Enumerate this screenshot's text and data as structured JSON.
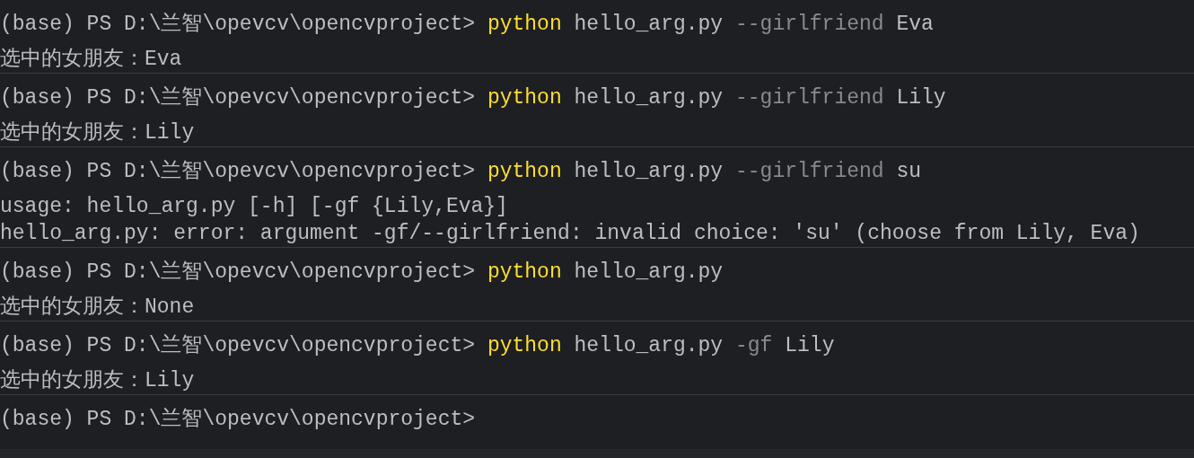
{
  "blocks": [
    {
      "prompt": "(base) PS D:\\兰智\\opevcv\\opencvproject>",
      "command": [
        {
          "text": "python",
          "kind": "program"
        },
        {
          "text": "hello_arg.py",
          "kind": "argument"
        },
        {
          "text": "--girlfriend",
          "kind": "flag"
        },
        {
          "text": "Eva",
          "kind": "argument"
        }
      ],
      "output": [
        "选中的女朋友：Eva"
      ]
    },
    {
      "prompt": "(base) PS D:\\兰智\\opevcv\\opencvproject>",
      "command": [
        {
          "text": "python",
          "kind": "program"
        },
        {
          "text": "hello_arg.py",
          "kind": "argument"
        },
        {
          "text": "--girlfriend",
          "kind": "flag"
        },
        {
          "text": "Lily",
          "kind": "argument"
        }
      ],
      "output": [
        "选中的女朋友：Lily"
      ]
    },
    {
      "prompt": "(base) PS D:\\兰智\\opevcv\\opencvproject>",
      "command": [
        {
          "text": "python",
          "kind": "program"
        },
        {
          "text": "hello_arg.py",
          "kind": "argument"
        },
        {
          "text": "--girlfriend",
          "kind": "flag"
        },
        {
          "text": "su",
          "kind": "argument"
        }
      ],
      "output": [
        "usage: hello_arg.py [-h] [-gf {Lily,Eva}]",
        "hello_arg.py: error: argument -gf/--girlfriend: invalid choice: 'su' (choose from Lily, Eva)"
      ]
    },
    {
      "prompt": "(base) PS D:\\兰智\\opevcv\\opencvproject>",
      "command": [
        {
          "text": "python",
          "kind": "program"
        },
        {
          "text": "hello_arg.py",
          "kind": "argument"
        }
      ],
      "output": [
        "选中的女朋友：None"
      ]
    },
    {
      "prompt": "(base) PS D:\\兰智\\opevcv\\opencvproject>",
      "command": [
        {
          "text": "python",
          "kind": "program"
        },
        {
          "text": "hello_arg.py",
          "kind": "argument"
        },
        {
          "text": "-gf",
          "kind": "flag"
        },
        {
          "text": "Lily",
          "kind": "argument"
        }
      ],
      "output": [
        "选中的女朋友：Lily"
      ]
    },
    {
      "prompt": "(base) PS D:\\兰智\\opevcv\\opencvproject>"
    }
  ]
}
